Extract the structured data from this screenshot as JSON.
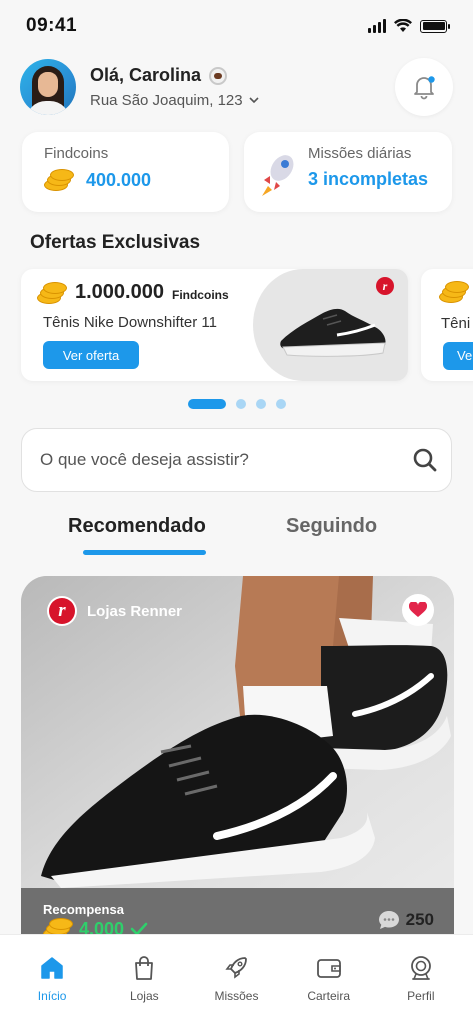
{
  "status_bar": {
    "time": "09:41"
  },
  "header": {
    "greeting": "Olá, Carolina",
    "address": "Rua São Joaquim, 123"
  },
  "stats": {
    "findcoins": {
      "label": "Findcoins",
      "value": "400.000"
    },
    "missions": {
      "label": "Missões diárias",
      "value": "3 incompletas"
    }
  },
  "offers": {
    "title": "Ofertas Exclusivas",
    "items": [
      {
        "amount": "1.000.000",
        "currency": "Findcoins",
        "product": "Tênis Nike Downshifter 11",
        "button": "Ver oferta"
      }
    ],
    "peek": {
      "product": "Têni",
      "button": "Ve"
    },
    "carousel_page": 1,
    "carousel_pages": 4
  },
  "search": {
    "placeholder": "O que você deseja assistir?"
  },
  "tabs": [
    {
      "label": "Recomendado",
      "active": true
    },
    {
      "label": "Seguindo",
      "active": false
    }
  ],
  "feed": {
    "store": "Lojas Renner",
    "reward_label": "Recompensa",
    "reward_value": "4.000",
    "comments": "250"
  },
  "bottom_nav": [
    {
      "label": "Início",
      "icon": "home-icon",
      "active": true
    },
    {
      "label": "Lojas",
      "icon": "shopping-bag-icon",
      "active": false
    },
    {
      "label": "Missões",
      "icon": "rocket-icon",
      "active": false
    },
    {
      "label": "Carteira",
      "icon": "wallet-icon",
      "active": false
    },
    {
      "label": "Perfil",
      "icon": "profile-icon",
      "active": false
    }
  ],
  "colors": {
    "primary": "#1d98ea",
    "reward": "#2fcf6b",
    "brand_renner": "#d7142b",
    "background": "#f7f7f7"
  }
}
